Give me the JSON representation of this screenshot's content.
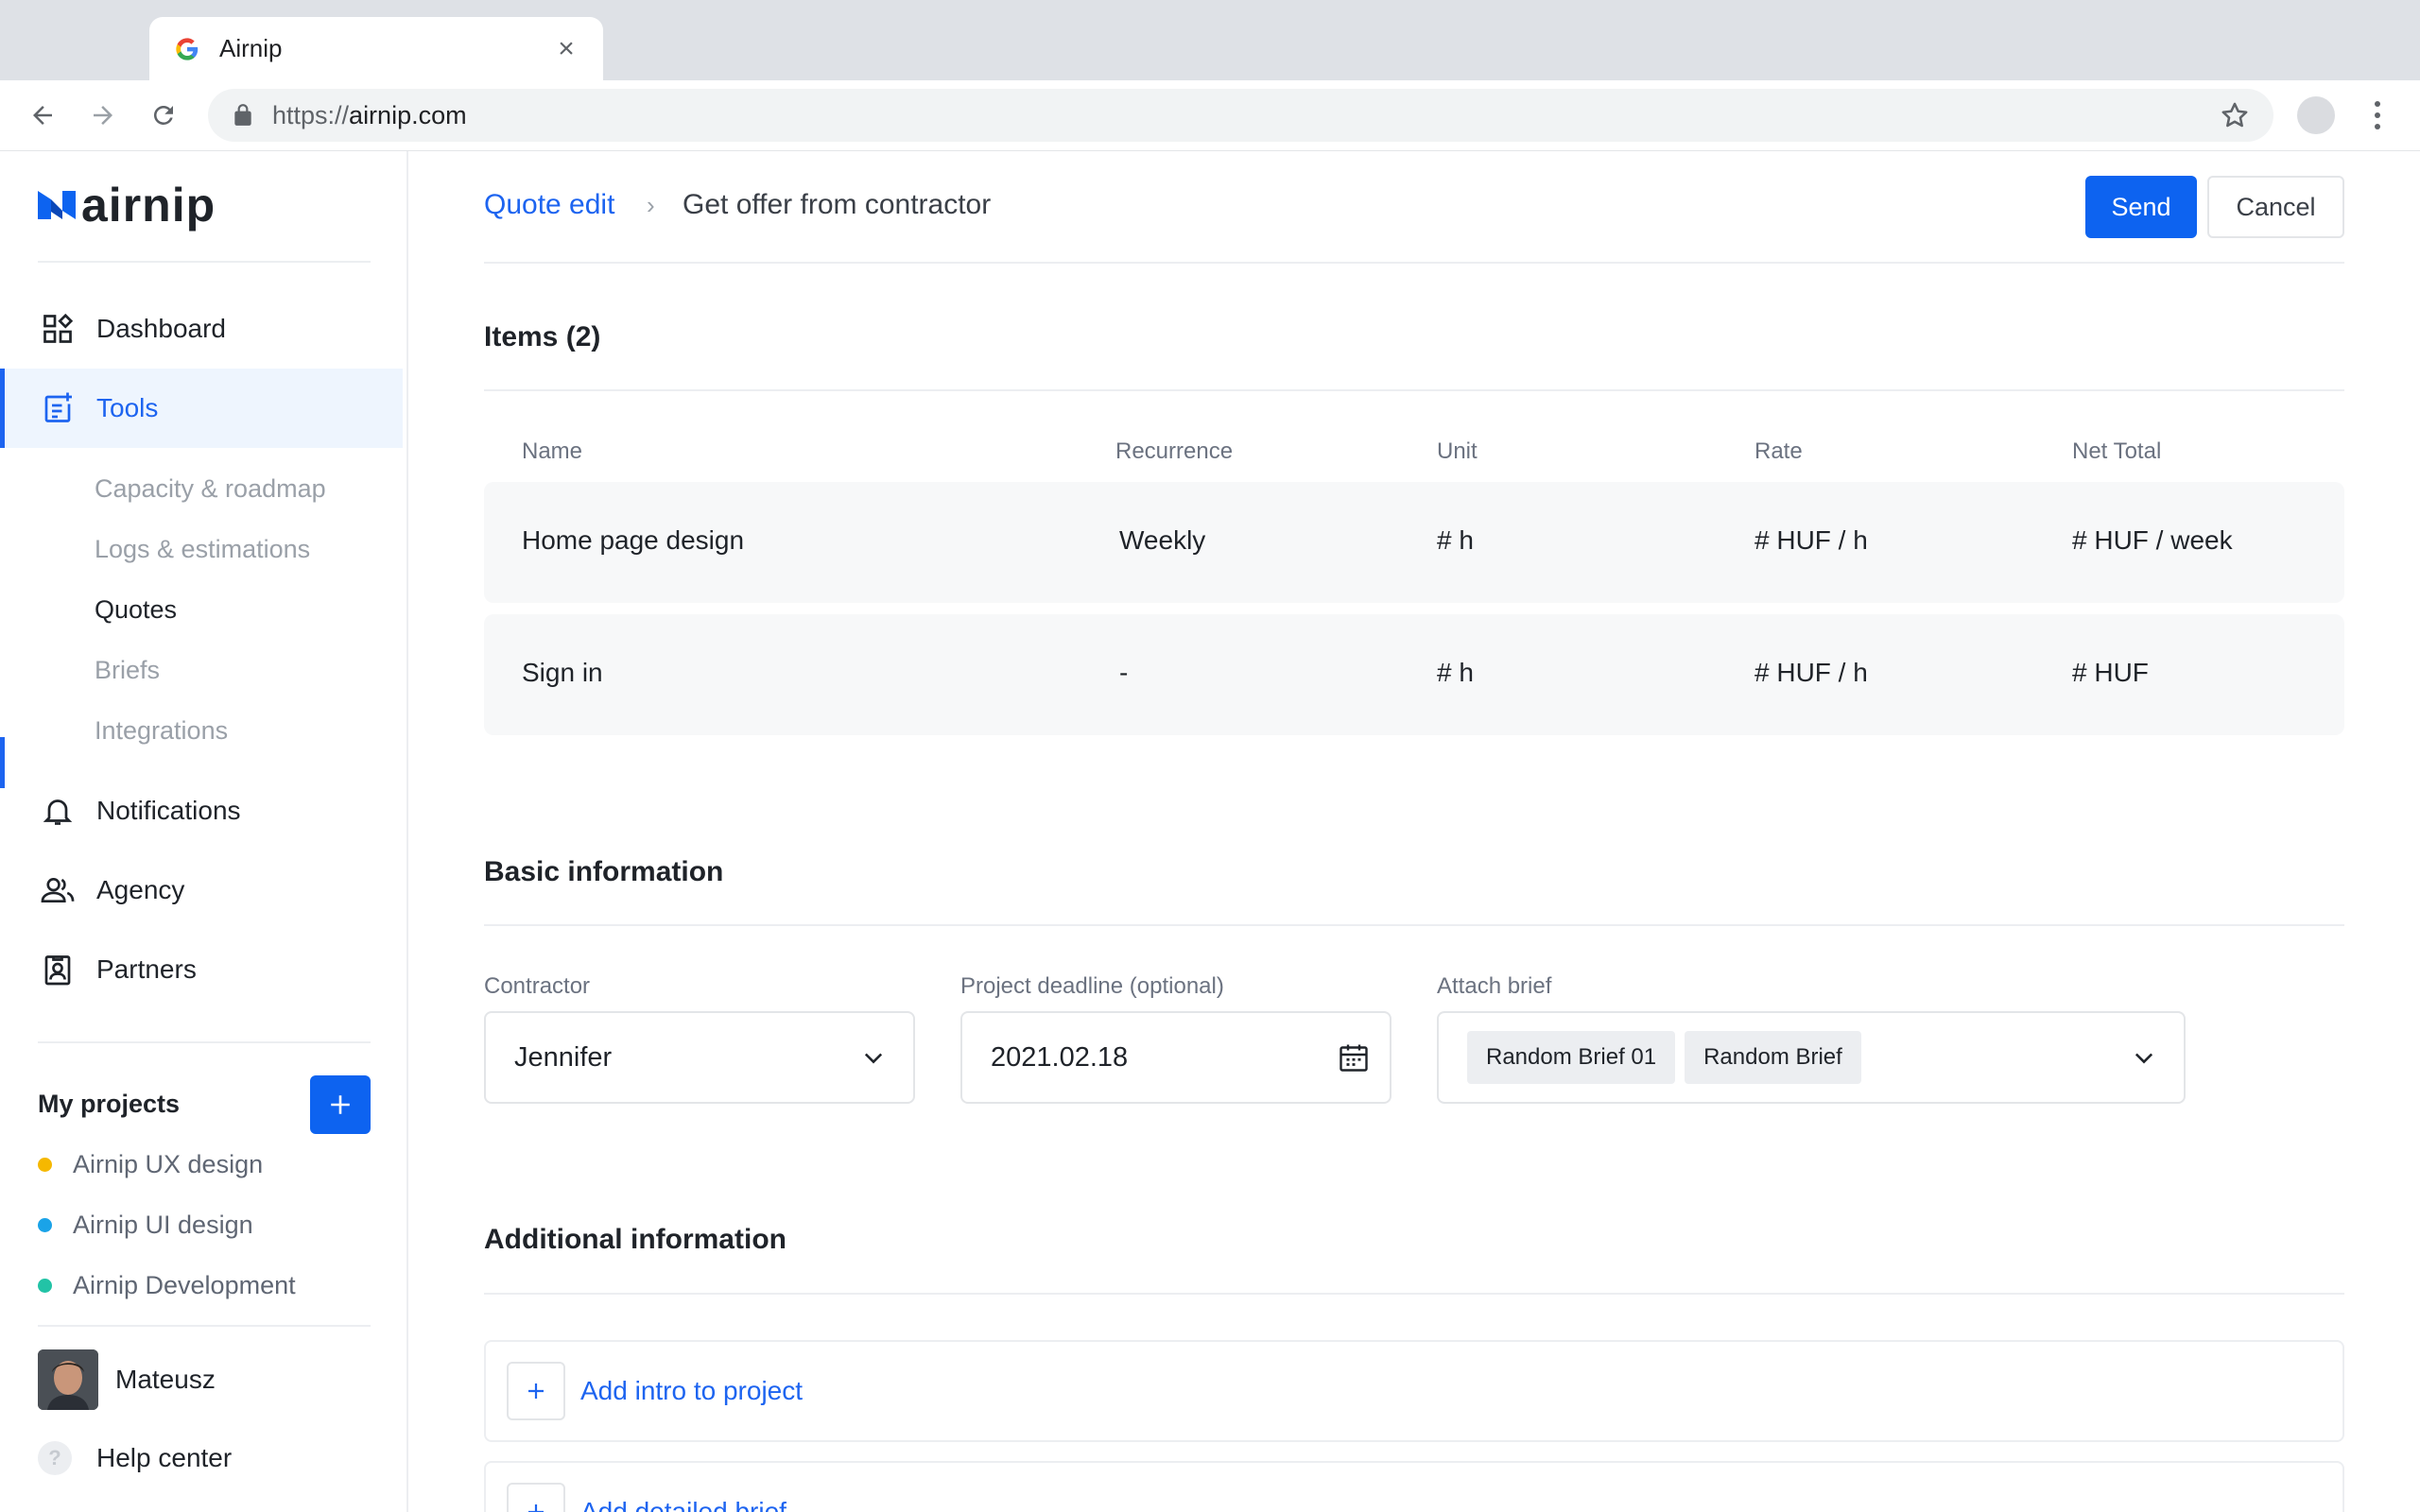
{
  "browser": {
    "tab_title": "Airnip",
    "url_scheme": "https://",
    "url_host": "airnip.com"
  },
  "sidebar": {
    "logo_text": "airnip",
    "nav": [
      {
        "label": "Dashboard",
        "icon": "dashboard-icon"
      },
      {
        "label": "Tools",
        "icon": "tools-icon",
        "active": true
      }
    ],
    "sub_items": [
      "Capacity & roadmap",
      "Logs & estimations",
      "Quotes",
      "Briefs",
      "Integrations"
    ],
    "nav2": [
      {
        "label": "Notifications",
        "icon": "bell-icon"
      },
      {
        "label": "Agency",
        "icon": "people-icon"
      },
      {
        "label": "Partners",
        "icon": "badge-icon"
      }
    ],
    "projects_label": "My projects",
    "projects": [
      {
        "name": "Airnip UX design",
        "color": "#f5b800"
      },
      {
        "name": "Airnip UI design",
        "color": "#1aa3e8"
      },
      {
        "name": "Airnip Development",
        "color": "#22c3a6"
      }
    ],
    "user_name": "Mateusz",
    "help": "Help center"
  },
  "header": {
    "breadcrumb_link": "Quote edit",
    "breadcrumb_current": "Get offer from contractor",
    "send": "Send",
    "cancel": "Cancel"
  },
  "items": {
    "title": "Items (2)",
    "columns": [
      "Name",
      "Recurrence",
      "Unit",
      "Rate",
      "Net Total"
    ],
    "rows": [
      [
        "Home page design",
        "Weekly",
        "# h",
        "# HUF / h",
        "# HUF / week"
      ],
      [
        "Sign in",
        "-",
        "# h",
        "# HUF / h",
        "# HUF"
      ]
    ]
  },
  "basic": {
    "title": "Basic information",
    "contractor_label": "Contractor",
    "contractor_value": "Jennifer",
    "deadline_label": "Project deadline (optional)",
    "deadline_value": "2021.02.18",
    "brief_label": "Attach brief",
    "brief_chips": [
      "Random Brief 01",
      "Random Brief"
    ]
  },
  "additional": {
    "title": "Additional information",
    "add_intro": "Add intro to project",
    "add_brief": "Add detailed brief"
  },
  "colors": {
    "accent": "#0d63f0",
    "link": "#1d64f0"
  }
}
